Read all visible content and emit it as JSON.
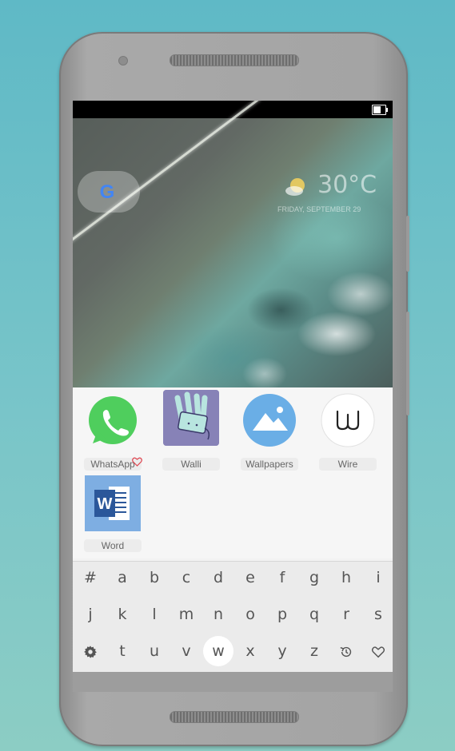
{
  "wallpaper": {
    "weather": {
      "temperature": "30°C",
      "date": "FRIDAY, SEPTEMBER 29"
    },
    "google_logo": "G"
  },
  "apps": [
    {
      "label": "WhatsApp",
      "icon": "whatsapp-icon"
    },
    {
      "label": "Walli",
      "icon": "walli-icon"
    },
    {
      "label": "Wallpapers",
      "icon": "wallpapers-icon"
    },
    {
      "label": "Wire",
      "icon": "wire-icon"
    },
    {
      "label": "Word",
      "icon": "word-icon"
    }
  ],
  "keyboard": {
    "row1": [
      "#",
      "a",
      "b",
      "c",
      "d",
      "e",
      "f",
      "g",
      "h",
      "i"
    ],
    "row2": [
      "j",
      "k",
      "l",
      "m",
      "n",
      "o",
      "p",
      "q",
      "r",
      "s"
    ],
    "row3": [
      "t",
      "u",
      "v",
      "w",
      "x",
      "y",
      "z"
    ],
    "active_key": "w",
    "icons": [
      "settings-gear-icon",
      "history-icon",
      "favorites-heart-icon"
    ]
  },
  "colors": {
    "background": "#6cc0c8",
    "whatsapp_green": "#4fce5d",
    "wallpapers_blue": "#6aaee6",
    "word_blue": "#2b579a"
  }
}
